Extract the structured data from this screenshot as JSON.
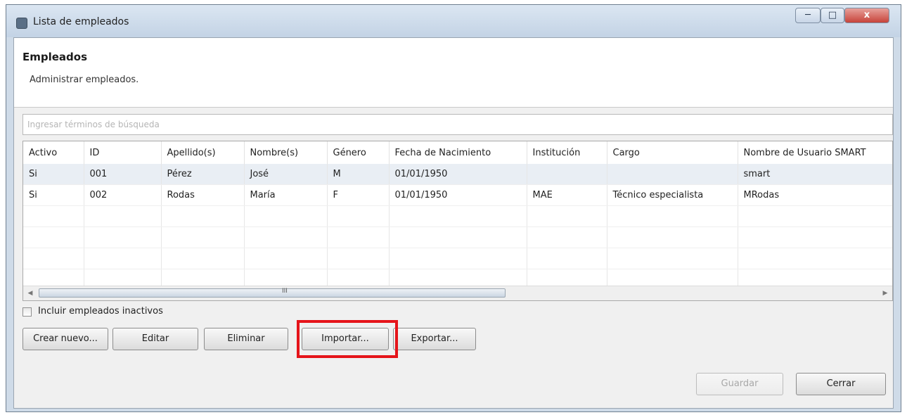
{
  "window": {
    "title": "Lista de empleados"
  },
  "banner": {
    "title": "Empleados",
    "description": "Administrar empleados."
  },
  "search": {
    "placeholder": "Ingresar términos de búsqueda",
    "value": ""
  },
  "table": {
    "columns": [
      "Activo",
      "ID",
      "Apellido(s)",
      "Nombre(s)",
      "Género",
      "Fecha de Nacimiento",
      "Institución",
      "Cargo",
      "Nombre de Usuario SMART"
    ],
    "rows": [
      [
        "Si",
        "001",
        "Pérez",
        "José",
        "M",
        "01/01/1950",
        "",
        "",
        "smart"
      ],
      [
        "Si",
        "002",
        "Rodas",
        "María",
        "F",
        "01/01/1950",
        "MAE",
        "Técnico especialista",
        "MRodas"
      ]
    ],
    "selected_row": 0
  },
  "scrollbar": {
    "left_arrow": "◀",
    "right_arrow": "▶",
    "grip": "III"
  },
  "include_inactive": {
    "label": "Incluir empleados inactivos",
    "checked": false
  },
  "actions": {
    "create": "Crear nuevo...",
    "edit": "Editar",
    "delete": "Eliminar",
    "import": "Importar...",
    "export": "Exportar..."
  },
  "footer": {
    "save": "Guardar",
    "close": "Cerrar"
  },
  "window_controls": {
    "minimize": "─",
    "maximize": "□",
    "close": "x"
  },
  "colors": {
    "highlight": "#e5141a",
    "selected_row": "#e9eef4",
    "titlebar": "#cfdbe8"
  }
}
